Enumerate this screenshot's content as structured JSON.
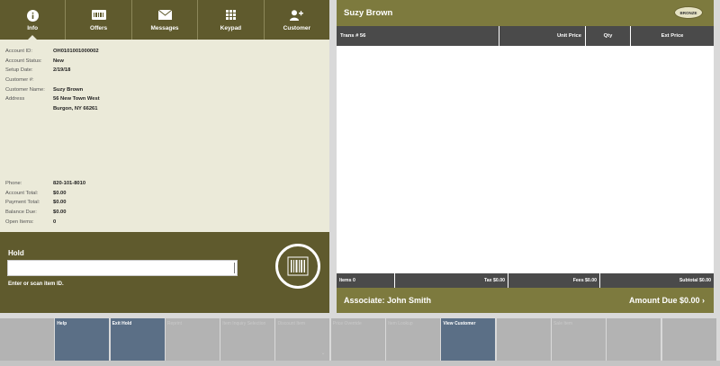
{
  "tabs": [
    {
      "label": "Info",
      "icon": "info-icon",
      "active": true
    },
    {
      "label": "Offers",
      "icon": "offers-icon"
    },
    {
      "label": "Messages",
      "icon": "envelope-icon"
    },
    {
      "label": "Keypad",
      "icon": "keypad-icon"
    },
    {
      "label": "Customer",
      "icon": "add-customer-icon"
    }
  ],
  "info": {
    "account_id": {
      "label": "Account ID:",
      "value": "OH0101001000002"
    },
    "account_status": {
      "label": "Account Status:",
      "value": "New"
    },
    "setup_date": {
      "label": "Setup Date:",
      "value": "2/19/18"
    },
    "customer_num": {
      "label": "Customer #:",
      "value": ""
    },
    "customer_name": {
      "label": "Customer Name:",
      "value": "Suzy Brown"
    },
    "address": {
      "label": "Address",
      "line1": "56 New Town West",
      "line2": "Burgon, NY 66261"
    },
    "phone": {
      "label": "Phone:",
      "value": "820-101-8010"
    },
    "account_total": {
      "label": "Account Total:",
      "value": "$0.00"
    },
    "payment_total": {
      "label": "Payment Total:",
      "value": "$0.00"
    },
    "balance_due": {
      "label": "Balance Due:",
      "value": "$0.00"
    },
    "open_items": {
      "label": "Open Items:",
      "value": "0"
    }
  },
  "hold": {
    "title": "Hold",
    "input_value": "",
    "hint": "Enter or scan item ID."
  },
  "header": {
    "customer_name": "Suzy Brown",
    "tier_badge": "BRONZE"
  },
  "table": {
    "columns": [
      "Trans # 56",
      "Unit Price",
      "Qty",
      "Ext Price"
    ]
  },
  "totals": {
    "items": "Items 0",
    "tax": "Tax $0.00",
    "fees": "Fees $0.00",
    "subtotal": "Subtotal $0.00"
  },
  "footer": {
    "associate": "Associate: John Smith",
    "amount_due": "Amount Due  $0.00  ›"
  },
  "function_keys": [
    {
      "label": "",
      "active": false
    },
    {
      "label": "Help",
      "active": true
    },
    {
      "label": "Exit Hold",
      "active": true
    },
    {
      "label": "Reprint",
      "active": false,
      "ghost": true
    },
    {
      "label": "Item Inquiry Selection",
      "active": false,
      "ghost": true
    },
    {
      "label": "Discount Item",
      "active": false,
      "ghost": true,
      "chevron": true
    },
    {
      "label": "Price Override",
      "active": false,
      "ghost": true
    },
    {
      "label": "Item Lookup",
      "active": false,
      "ghost": true
    },
    {
      "label": "View Customer",
      "active": true
    },
    {
      "label": "",
      "active": false
    },
    {
      "label": "Sale Item",
      "active": false,
      "ghost": true
    },
    {
      "label": "",
      "active": false
    },
    {
      "label": "",
      "active": false
    }
  ],
  "colors": {
    "olive_dark": "#5f5a2d",
    "olive": "#7d7a3e",
    "key_blue": "#5b6f86",
    "key_grey": "#b3b3b3"
  }
}
